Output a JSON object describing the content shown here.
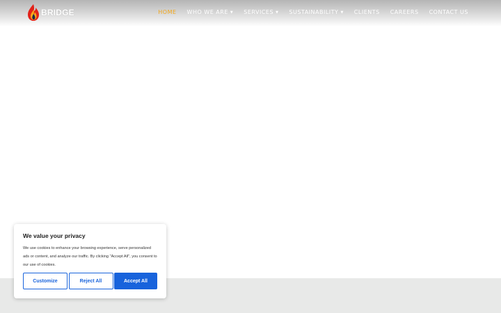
{
  "brand": {
    "name": "BRIDGE"
  },
  "nav": {
    "items": [
      {
        "label": "HOME",
        "active": true,
        "has_dropdown": false
      },
      {
        "label": "WHO WE ARE",
        "active": false,
        "has_dropdown": true
      },
      {
        "label": "SERVICES",
        "active": false,
        "has_dropdown": true
      },
      {
        "label": "SUSTAINABILITY",
        "active": false,
        "has_dropdown": true
      },
      {
        "label": "CLIENTS",
        "active": false,
        "has_dropdown": false
      },
      {
        "label": "CAREERS",
        "active": false,
        "has_dropdown": false
      },
      {
        "label": "CONTACT US",
        "active": false,
        "has_dropdown": false
      }
    ]
  },
  "cookie_banner": {
    "title": "We value your privacy",
    "text": "We use cookies to enhance your browsing experience, serve personalized ads or content, and analyze our traffic. By clicking \"Accept All\", you consent to our use of cookies.",
    "customize_label": "Customize",
    "reject_label": "Reject All",
    "accept_label": "Accept All"
  },
  "colors": {
    "accent": "#f2a81d",
    "primary_button": "#1863dc",
    "footer_band": "#e8e9e8"
  }
}
